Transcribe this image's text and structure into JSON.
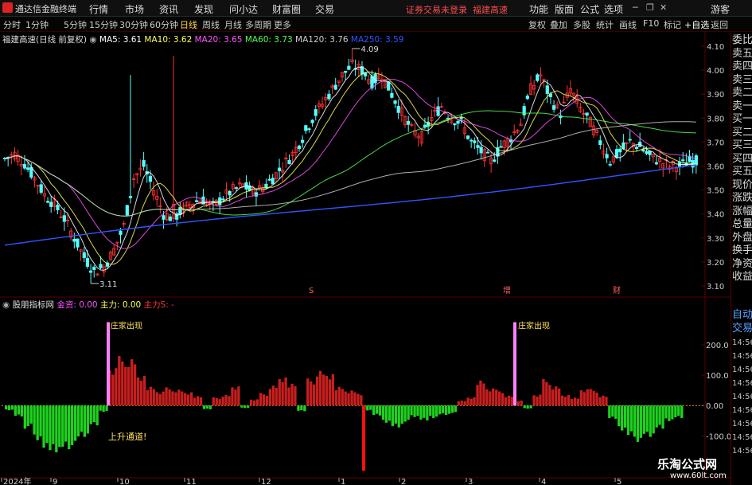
{
  "app": {
    "title": "通达信金融终端",
    "menu": [
      "行情",
      "市场",
      "资讯",
      "发现",
      "问小达",
      "财富圈",
      "交易"
    ],
    "status": "证券交易未登录",
    "stock_name": "福建高速",
    "right_menu": [
      "功能",
      "版面",
      "公式",
      "选项"
    ],
    "user": "游客"
  },
  "toolbar": {
    "periods": [
      "分时",
      "1分钟",
      "5分钟",
      "15分钟",
      "30分钟",
      "60分钟",
      "日线",
      "周线",
      "月线",
      "多周期",
      "更多"
    ],
    "active_period": "日线",
    "buttons": [
      "复权",
      "叠加",
      "多股",
      "统计",
      "画线",
      "F10",
      "标记",
      "+自选",
      "返回"
    ]
  },
  "main_legend": {
    "title": "福建高速(日线 前复权)",
    "items": [
      {
        "label": "MA5: 3.61",
        "color": "#ffffff"
      },
      {
        "label": "MA10: 3.62",
        "color": "#ffff55"
      },
      {
        "label": "MA20: 3.65",
        "color": "#ff55ff"
      },
      {
        "label": "MA60: 3.73",
        "color": "#55ff55"
      },
      {
        "label": "MA120: 3.76",
        "color": "#cccccc"
      },
      {
        "label": "MA250: 3.59",
        "color": "#3355ff"
      }
    ]
  },
  "sub_legend": {
    "title": "股朋指标网",
    "items": [
      {
        "label": "金资: 0.00",
        "color": "#ff55ff"
      },
      {
        "label": "主力: 0.00",
        "color": "#ffff55"
      },
      {
        "label": "主力S: -",
        "color": "#ff3333"
      }
    ]
  },
  "annotations": {
    "high": "4.09",
    "low": "3.11",
    "zhuang1": "庄家出现",
    "zhuang2": "庄家出现",
    "uptrend": "上升通道!",
    "marker_s": "S",
    "marker_zeng": "增",
    "marker_cai": "财"
  },
  "sidebar": {
    "items": [
      "委比",
      "卖五",
      "卖四",
      "卖三",
      "卖二",
      "卖一",
      "买一",
      "买二",
      "买三",
      "买四",
      "买五",
      "现价",
      "涨跌",
      "涨幅",
      "总量",
      "外盘",
      "换手",
      "净资",
      "收益",
      "自动",
      "交易"
    ],
    "times": [
      "14:56",
      "14:56",
      "14:56",
      "14:56",
      "14:56",
      "14:56",
      "14:56",
      "14:56",
      "14:56"
    ]
  },
  "watermark": {
    "main": "乐淘公式网",
    "sub": "www.60lt.com"
  },
  "colors": {
    "up": "#ff3232",
    "down": "#54ffff",
    "grid": "#5a0000",
    "bar_pos": "#c81e1e",
    "bar_neg": "#1ed21e"
  },
  "chart_data": [
    {
      "type": "candlestick",
      "title": "福建高速(日线 前复权)",
      "ylim": [
        3.08,
        4.12
      ],
      "yticks": [
        "4.10",
        "4.00",
        "3.90",
        "3.80",
        "3.70",
        "3.60",
        "3.50",
        "3.40",
        "3.30",
        "3.20",
        "3.10"
      ],
      "x_labels": [
        "2024年",
        "9",
        "10",
        "11",
        "12",
        "1",
        "2",
        "3",
        "4",
        "5"
      ],
      "high_marker": 4.09,
      "low_marker": 3.11,
      "close_path": [
        3.63,
        3.65,
        3.61,
        3.55,
        3.48,
        3.44,
        3.38,
        3.3,
        3.22,
        3.16,
        3.18,
        3.25,
        3.35,
        3.55,
        3.6,
        3.5,
        3.4,
        3.38,
        3.42,
        3.45,
        3.46,
        3.43,
        3.47,
        3.5,
        3.52,
        3.49,
        3.51,
        3.55,
        3.6,
        3.65,
        3.72,
        3.8,
        3.86,
        3.92,
        3.98,
        4.02,
        4.0,
        3.95,
        3.98,
        3.9,
        3.82,
        3.75,
        3.72,
        3.8,
        3.85,
        3.8,
        3.78,
        3.7,
        3.66,
        3.62,
        3.68,
        3.72,
        3.78,
        3.92,
        3.98,
        3.88,
        3.82,
        3.92,
        3.84,
        3.78,
        3.7,
        3.62,
        3.66,
        3.7,
        3.68,
        3.64,
        3.62,
        3.6,
        3.6,
        3.62
      ],
      "series": [
        {
          "name": "MA5",
          "value": 3.61
        },
        {
          "name": "MA10",
          "value": 3.62
        },
        {
          "name": "MA20",
          "value": 3.65
        },
        {
          "name": "MA60",
          "value": 3.73
        },
        {
          "name": "MA120",
          "value": 3.76
        },
        {
          "name": "MA250",
          "value": 3.59
        }
      ]
    },
    {
      "type": "bar",
      "title": "股朋指标网",
      "ylim": [
        -220,
        300
      ],
      "yticks": [
        "200.0",
        "100.0",
        "0.00",
        "-100.0"
      ],
      "values": [
        -15,
        -35,
        -70,
        -105,
        -135,
        -150,
        -140,
        -120,
        -95,
        -60,
        -20,
        120,
        150,
        140,
        90,
        60,
        45,
        55,
        48,
        40,
        30,
        -12,
        25,
        32,
        58,
        -8,
        20,
        38,
        60,
        85,
        70,
        -18,
        82,
        105,
        95,
        60,
        48,
        40,
        -15,
        -30,
        -55,
        -70,
        -55,
        -35,
        -45,
        -40,
        -30,
        -25,
        15,
        25,
        80,
        55,
        48,
        30,
        15,
        -10,
        35,
        80,
        58,
        32,
        25,
        52,
        50,
        30,
        -40,
        -80,
        -100,
        -110,
        -95,
        -70,
        -50,
        -40
      ],
      "special": [
        {
          "value": 275,
          "label": "庄家出现"
        },
        {
          "value": -215,
          "label": "主力S"
        }
      ]
    }
  ]
}
